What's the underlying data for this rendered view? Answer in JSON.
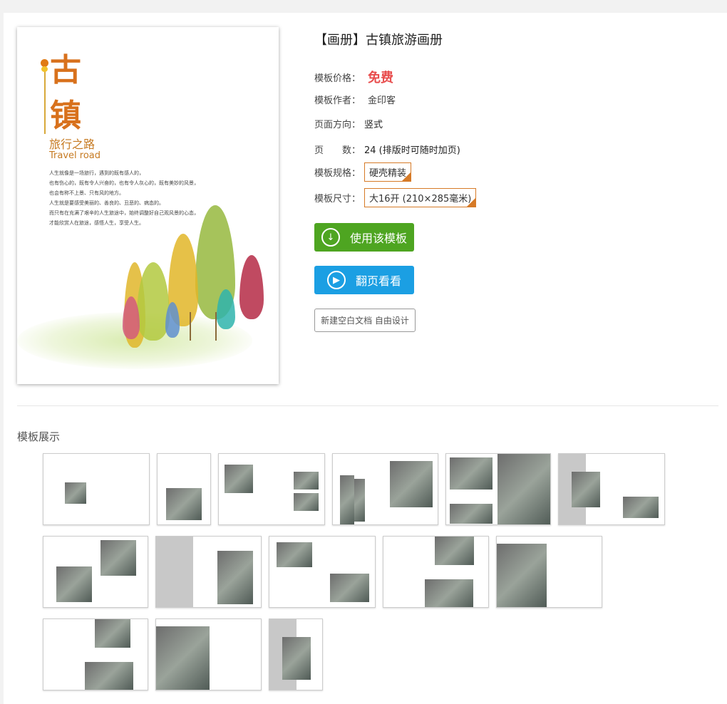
{
  "cover": {
    "char1": "古",
    "char2": "镇",
    "subtitle_cn": "旅行之路",
    "subtitle_en": "Travel road",
    "poem": [
      "人生就像是一场旅行，遇到的既有感人的，",
      "也有伤心的，既有令人兴奋的，也有令人灰心的，既有美妙的风景，",
      "也会有称不上景、只有风的地方。",
      "人生就是要感受美丽的、善良的、丑恶的、病态的。",
      "而只有在充满了艰辛的人生旅途中，始终调整好自己观风景的心态，",
      "才能欣赏人在旅途，感悟人生，享受人生。"
    ]
  },
  "title": "【画册】古镇旅游画册",
  "info": [
    {
      "label": "模板价格：",
      "value": "免费"
    },
    {
      "label": "模板作者：",
      "value": "金印客"
    },
    {
      "label": "页面方向：",
      "value": "竖式"
    },
    {
      "label": "页　　数：",
      "value": "24 (排版时可随时加页)"
    },
    {
      "label": "模板规格：",
      "value": "硬壳精装"
    },
    {
      "label": "模板尺寸：",
      "value": "大16开 (210×285毫米)"
    }
  ],
  "buttons": {
    "use": "使用该模板",
    "flip": "翻页看看",
    "blank": "新建空白文档 自由设计"
  },
  "colors": {
    "green": "#4ea521",
    "blue": "#1b9fe3",
    "price": "#e84d4d",
    "option_border": "#d67a27"
  },
  "section_title": "模板展示",
  "thumbnails": {
    "count": 14
  }
}
